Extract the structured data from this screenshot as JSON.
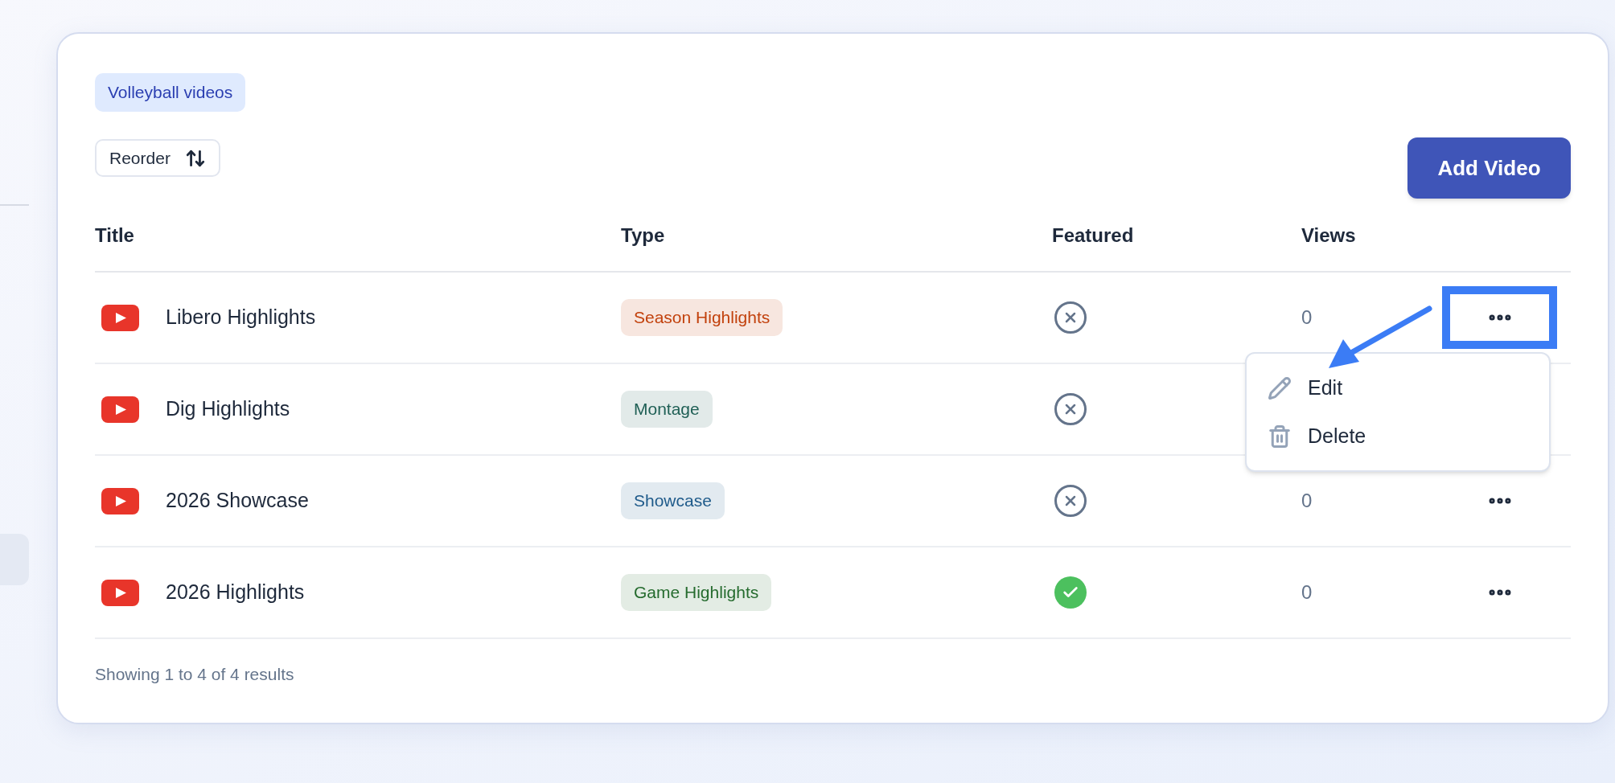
{
  "collection_badge": "Volleyball videos",
  "reorder_button": "Reorder",
  "add_button": "Add Video",
  "table": {
    "columns": [
      "Title",
      "Type",
      "Featured",
      "Views"
    ],
    "rows": [
      {
        "title": "Libero Highlights",
        "type": "Season Highlights",
        "color": "#c2410c",
        "featured": false,
        "views": "0",
        "annotated": true
      },
      {
        "title": "Dig Highlights",
        "type": "Montage",
        "color": "#1f5f55",
        "featured": false
      },
      {
        "title": "2026 Showcase",
        "type": "Showcase",
        "color": "#1e5a8a",
        "featured": false,
        "views": "0",
        "annotated": false
      },
      {
        "title": "2026 Highlights",
        "type": "Game Highlights",
        "color": "#256b2e",
        "featured": true,
        "views": "0",
        "annotated": false
      }
    ]
  },
  "menu": {
    "items": [
      {
        "kind": "edit",
        "label": "Edit"
      },
      {
        "kind": "delete",
        "label": "Delete"
      }
    ]
  },
  "footer": "Showing 1 to 4 of 4 results"
}
